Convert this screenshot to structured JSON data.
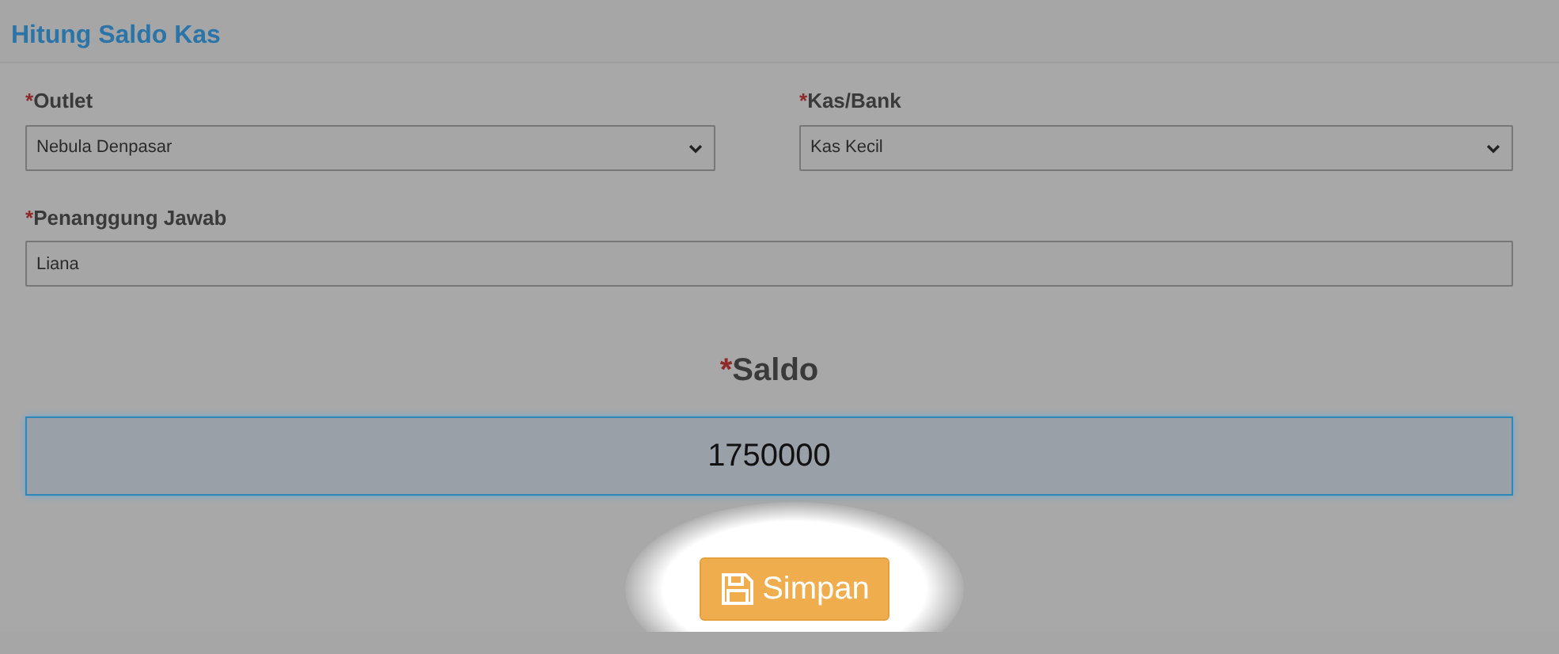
{
  "title": "Hitung Saldo Kas",
  "fields": [
    {
      "mark": "*",
      "label": "Outlet",
      "kind": "select",
      "value": "Nebula Denpasar"
    },
    {
      "mark": "*",
      "label": "Kas/Bank",
      "kind": "select",
      "value": "Kas Kecil"
    },
    {
      "mark": "*",
      "label": "Penanggung Jawab",
      "kind": "text",
      "value": "Liana"
    }
  ],
  "saldo": {
    "mark": "*",
    "label": "Saldo",
    "value": "1750000"
  },
  "save_button": {
    "label": "Simpan"
  }
}
